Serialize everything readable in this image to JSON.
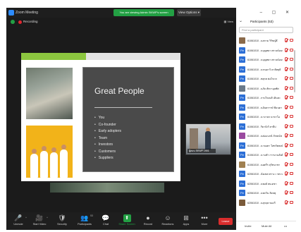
{
  "window": {
    "title": "Zoom Meeting"
  },
  "banner": {
    "text": "You are viewing Admin SKWP's screen",
    "view_options": "View Options ▾"
  },
  "recording": {
    "label": "Recording",
    "view": "▦ View"
  },
  "slide": {
    "heading": "Great People",
    "bullets": [
      "You",
      "Co-founder",
      "Early adopters",
      "Team",
      "Investors",
      "Customers",
      "Suppliers"
    ]
  },
  "video": {
    "name_tag": "ผู้สอน SKWP 1901"
  },
  "toolbar": {
    "items": [
      {
        "icon": "🎤",
        "label": "Unmute"
      },
      {
        "icon": "🎥",
        "label": "Start Video"
      },
      {
        "icon": "🛡",
        "label": "Security"
      },
      {
        "icon": "👥",
        "label": "Participants",
        "badge": "53"
      },
      {
        "icon": "💬",
        "label": "Chat"
      },
      {
        "icon": "⬆",
        "label": "Share Screen"
      },
      {
        "icon": "●",
        "label": "Record"
      },
      {
        "icon": "☺",
        "label": "Reactions"
      },
      {
        "icon": "⊞",
        "label": "Apps"
      },
      {
        "icon": "•••",
        "label": "More"
      }
    ],
    "end_label": "Leave"
  },
  "participants": {
    "title": "Participants (53)",
    "search_placeholder": "Find a participant",
    "window_controls": "–  ▢  ✕",
    "items": [
      {
        "name": "61061010 ..นสกาย วิรัชญ์ธี",
        "avatar": "",
        "color": "#8a6a4a"
      },
      {
        "name": "61061010 ..นบุญทยา ศรวงษ์อนหนู",
        "avatar": "Pe",
        "color": "#2d6fd6"
      },
      {
        "name": "61061010 ..นบุญทยา ศรวงษ์อนหนู",
        "avatar": "Pe",
        "color": "#2d6fd6"
      },
      {
        "name": "61061010 ..นรณดาวิ คาลิทสุธิ",
        "avatar": "Pe",
        "color": "#2d6fd6"
      },
      {
        "name": "61061010 ..ทสุกส ต่อไขวก",
        "avatar": "Pe",
        "color": "#2d6fd6"
      },
      {
        "name": "61061010 ..นภัล สัตวาอุลทัศ",
        "avatar": "",
        "color": "#6a7a8a"
      },
      {
        "name": "61061010 ..กาบไขเนสิ เดินตะ",
        "avatar": "Pe",
        "color": "#2d6fd6"
      },
      {
        "name": "61061010 ..นอันดรารษ์ ฟ้อนดา",
        "avatar": "Pe",
        "color": "#2d6fd6"
      },
      {
        "name": "61061010 ..นาจาลก นาขาโอ",
        "avatar": "Pe",
        "color": "#2d6fd6"
      },
      {
        "name": "61061010 ..ริยาจังวิ สายีบ่",
        "avatar": "Pe",
        "color": "#2d6fd6"
      },
      {
        "name": "61061010 ..นต่อแนกนั ภักษณ์ช",
        "avatar": "",
        "color": "#9a4aa0"
      },
      {
        "name": "61061010 ..นาลอตา โสทวัตพงษ์",
        "avatar": "Pe",
        "color": "#2d6fd6"
      },
      {
        "name": "61061010 ..นานชำ การบานลัยดี",
        "avatar": "Pe",
        "color": "#2d6fd6"
      },
      {
        "name": "61061010 ..นยศวีร สุวิทนาชา",
        "avatar": "",
        "color": "#a08050"
      },
      {
        "name": "62061010 ..นัยเชส ศราง ะ พระนุย",
        "avatar": "Pe",
        "color": "#2d6fd6"
      },
      {
        "name": "62061010 ..นพงศ์ สนเดชา",
        "avatar": "Pe",
        "color": "#2d6fd6"
      },
      {
        "name": "62061010 ..นพกวิน สิงหพุ",
        "avatar": "Pe",
        "color": "#2d6fd6"
      },
      {
        "name": "62061010 ..นสุกฤต ทองวี",
        "avatar": "",
        "color": "#7a5a3a"
      }
    ],
    "footer": {
      "invite": "Invite",
      "mute_all": "Mute All",
      "more": "•••"
    }
  }
}
